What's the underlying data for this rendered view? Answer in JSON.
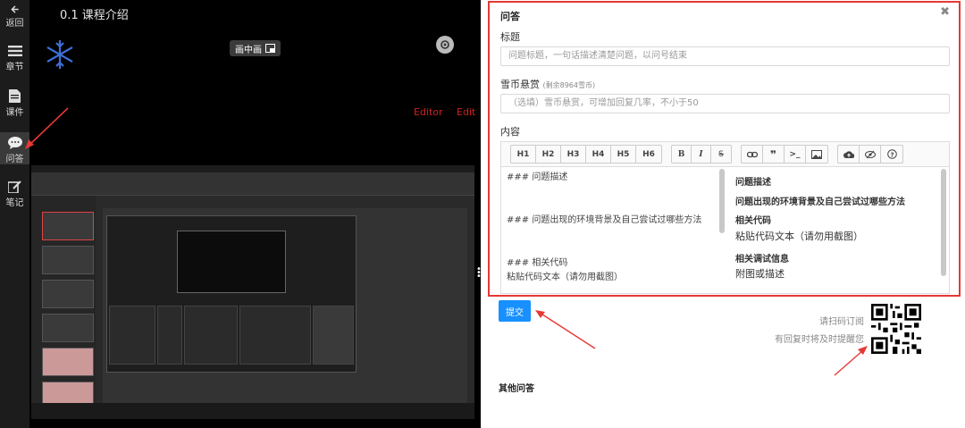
{
  "sidebar": {
    "back": "返回",
    "chapters": "章节",
    "courseware": "课件",
    "qa": "问答",
    "notes": "笔记"
  },
  "video": {
    "title": "0.1 课程介绍",
    "pip_label": "画中画",
    "editor_text_1": "Editor",
    "editor_text_2": "Edit"
  },
  "form": {
    "heading": "问答",
    "title_label": "标题",
    "title_placeholder": "问题标题，一句话描述清楚问题，以问号结束",
    "bounty_label": "雪币悬赏",
    "bounty_hint": "(剩余8964雪币)",
    "bounty_placeholder": "（选填）雪币悬赏，可增加回复几率，不小于50",
    "content_label": "内容",
    "toolbar": {
      "headings": [
        "H1",
        "H2",
        "H3",
        "H4",
        "H5",
        "H6"
      ],
      "format": [
        "B",
        "I",
        "S"
      ]
    },
    "markdown_source": "### 问题描述\n\n\n### 问题出现的环境背景及自己尝试过哪些方法\n\n\n### 相关代码\n粘贴代码文本（请勿用截图）",
    "preview": {
      "h1": "问题描述",
      "h2": "问题出现的环境背景及自己尝试过哪些方法",
      "h3": "相关代码",
      "p3": "粘贴代码文本（请勿用截图）",
      "h4": "相关调试信息",
      "p4": "附图或描述"
    },
    "submit": "提交"
  },
  "qr": {
    "line1": "请扫码订阅",
    "line2": "有回复时将及时提醒您"
  },
  "others": "其他问答",
  "colors": {
    "highlight": "#e53935",
    "primary": "#1890ff"
  }
}
